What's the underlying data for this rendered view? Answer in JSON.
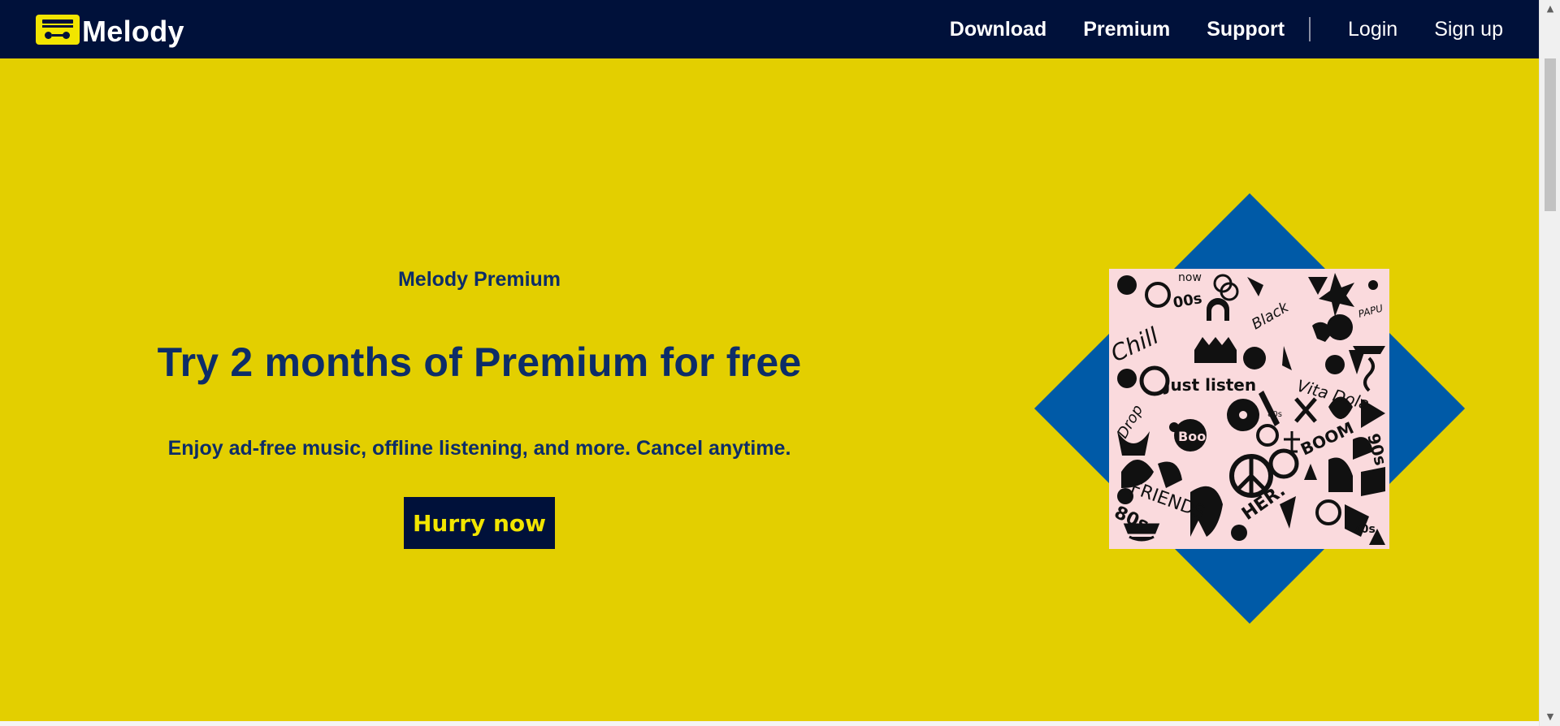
{
  "brand": {
    "name": "Melody",
    "accent": "#f2e500",
    "navy": "#00113a",
    "background": "#e3cf00",
    "diamond": "#005aa7"
  },
  "nav": {
    "links": [
      {
        "label": "Download"
      },
      {
        "label": "Premium"
      },
      {
        "label": "Support"
      }
    ],
    "login": "Login",
    "signup": "Sign up"
  },
  "hero": {
    "eyebrow": "Melody Premium",
    "headline": "Try 2 months of Premium for free",
    "subline": "Enjoy ad-free music, offline listening, and more. Cancel anytime.",
    "cta": "Hurry now"
  },
  "artwork": {
    "words": [
      "now",
      "00s",
      "Chill",
      "Black",
      "Just listen",
      "Vita Dola",
      "Drop",
      "Boo",
      "BOOM",
      "90s",
      "FRIENDS",
      "HER.",
      "80s",
      "70s",
      "80s",
      "PAPU"
    ]
  },
  "icons": {
    "logo": "boombox-icon",
    "scroll_up": "chevron-up-icon",
    "scroll_down": "chevron-down-icon"
  }
}
